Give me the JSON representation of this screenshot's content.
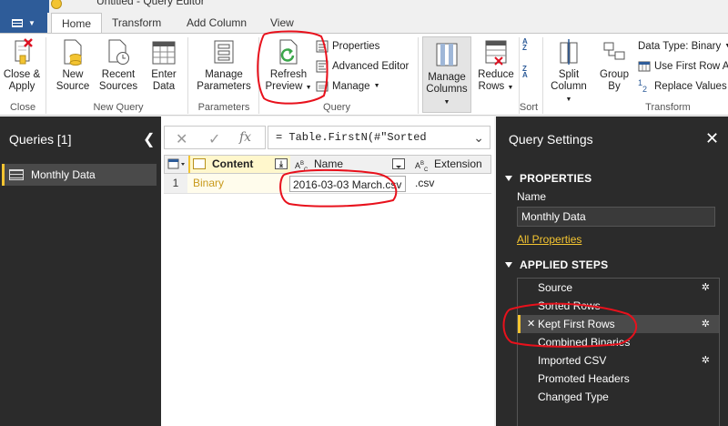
{
  "window": {
    "title": "Untitled - Query Editor"
  },
  "tabs": [
    {
      "label": "Home",
      "active": true
    },
    {
      "label": "Transform",
      "active": false
    },
    {
      "label": "Add Column",
      "active": false
    },
    {
      "label": "View",
      "active": false
    }
  ],
  "ribbon": {
    "close": {
      "label1": "Close &",
      "label2": "Apply",
      "group": "Close"
    },
    "new_source": {
      "label1": "New",
      "label2": "Source"
    },
    "recent_sources": {
      "label1": "Recent",
      "label2": "Sources"
    },
    "enter_data": {
      "label1": "Enter",
      "label2": "Data"
    },
    "new_query_group": "New Query",
    "manage_params": {
      "label1": "Manage",
      "label2": "Parameters"
    },
    "params_group": "Parameters",
    "refresh": {
      "label1": "Refresh",
      "label2": "Preview"
    },
    "properties": "Properties",
    "advanced_editor": "Advanced Editor",
    "manage": "Manage",
    "query_group": "Query",
    "manage_columns": {
      "label1": "Manage",
      "label2": "Columns"
    },
    "reduce_rows": {
      "label1": "Reduce",
      "label2": "Rows"
    },
    "sort_group": "Sort",
    "split_column": {
      "label1": "Split",
      "label2": "Column"
    },
    "group_by": {
      "label1": "Group",
      "label2": "By"
    },
    "data_type": "Data Type: Binary",
    "use_first_row": "Use First Row A",
    "replace_values": "Replace Values",
    "transform_group": "Transform"
  },
  "queries_panel": {
    "title": "Queries [1]",
    "items": [
      "Monthly Data"
    ]
  },
  "formula_bar": {
    "fx": "fx",
    "formula": "= Table.FirstN(#\"Sorted"
  },
  "grid": {
    "columns": [
      {
        "name": "Content",
        "type": "binary"
      },
      {
        "name": "Name",
        "type": "text"
      },
      {
        "name": "Extension",
        "type": "text"
      }
    ],
    "rows": [
      {
        "num": "1",
        "content": "Binary",
        "name": "2016-03-03 March.csv",
        "ext": ".csv"
      }
    ]
  },
  "settings": {
    "title": "Query Settings",
    "properties_header": "PROPERTIES",
    "name_label": "Name",
    "name_value": "Monthly Data",
    "all_properties": "All Properties",
    "steps_header": "APPLIED STEPS",
    "steps": [
      {
        "label": "Source",
        "gear": true,
        "active": false
      },
      {
        "label": "Sorted Rows",
        "gear": false,
        "active": false
      },
      {
        "label": "Kept First Rows",
        "gear": true,
        "active": true
      },
      {
        "label": "Combined Binaries",
        "gear": false,
        "active": false
      },
      {
        "label": "Imported CSV",
        "gear": true,
        "active": false
      },
      {
        "label": "Promoted Headers",
        "gear": false,
        "active": false
      },
      {
        "label": "Changed Type",
        "gear": false,
        "active": false
      }
    ]
  },
  "colors": {
    "accent": "#f3c431",
    "file_tab": "#2e5c99",
    "annotation": "#e8111c",
    "panel_dark": "#2b2b2b"
  }
}
